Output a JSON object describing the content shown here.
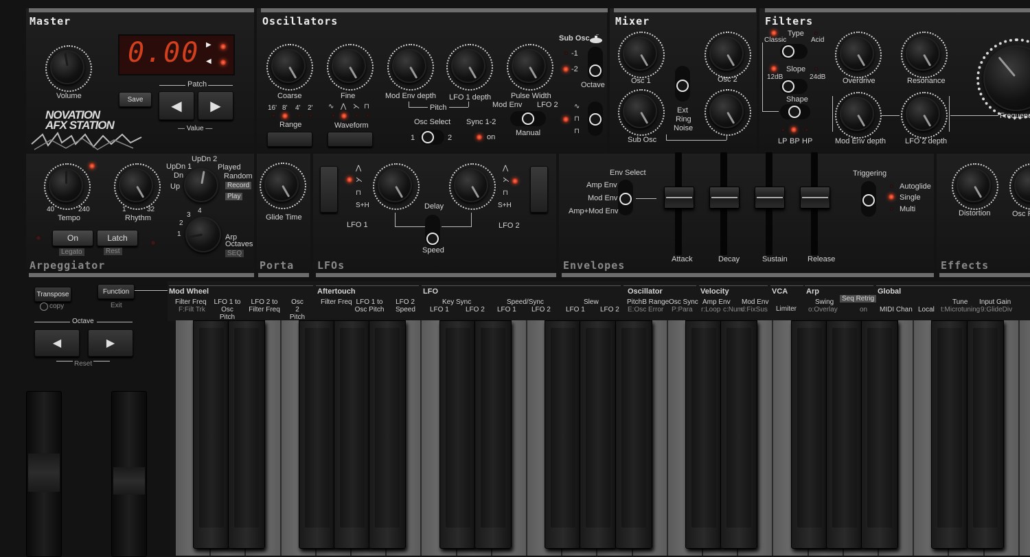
{
  "master": {
    "title": "Master",
    "volume": "Volume",
    "display": "0.00",
    "save": "Save",
    "patch": "Patch",
    "value": "— Value —",
    "brand1": "NOVATION",
    "brand2": "AFX STATION",
    "arrows": [
      "◀",
      "▶"
    ]
  },
  "oscillators": {
    "title": "Oscillators",
    "coarse": "Coarse",
    "fine": "Fine",
    "mod_env_depth": "Mod Env depth",
    "lfo1_depth": "LFO 1 depth",
    "pulse_width": "Pulse Width",
    "pitch": "Pitch",
    "range": "Range",
    "range_opts": [
      "16'",
      "8'",
      "4'",
      "2'"
    ],
    "waveform": "Waveform",
    "waveform_opts": [
      "∿",
      "⋀",
      "⋋",
      "⊓"
    ],
    "osc_select": "Osc Select",
    "osc_sel_1": "1",
    "osc_sel_2": "2",
    "sync": "Sync 1-2",
    "sync_on": "on",
    "mod_env": "Mod Env",
    "lfo2": "LFO 2",
    "manual": "Manual",
    "sub_osc": "Sub Osc",
    "sub_m1": "-1",
    "sub_m2": "-2",
    "octave": "Octave"
  },
  "mixer": {
    "title": "Mixer",
    "osc1": "Osc 1",
    "osc2": "Osc 2",
    "sub_osc": "Sub Osc",
    "ext1": "Ext",
    "ext2": "Ring",
    "ext3": "Noise"
  },
  "filters": {
    "title": "Filters",
    "type": "Type",
    "classic": "Classic",
    "acid": "Acid",
    "slope": "Slope",
    "db12": "12dB",
    "db24": "24dB",
    "shape": "Shape",
    "lp": "LP",
    "bp": "BP",
    "hp": "HP",
    "overdrive": "Overdrive",
    "resonance": "Resonance",
    "mod_env_depth": "Mod Env depth",
    "lfo2_depth": "LFO 2 depth",
    "frequency": "Frequency"
  },
  "arp": {
    "title": "Arpeggiator",
    "updn2": "UpDn 2",
    "updn1": "UpDn 1",
    "played": "Played",
    "dn": "Dn",
    "random": "Random",
    "up": "Up",
    "record": "Record",
    "play": "Play",
    "t40": "40",
    "t240": "240",
    "tempo": "Tempo",
    "r1": "1",
    "r32": "32",
    "rhythm": "Rhythm",
    "on": "On",
    "latch": "Latch",
    "legato": "Legato",
    "rest": "Rest",
    "oct1": "1",
    "oct2": "2",
    "oct3": "3",
    "oct4": "4",
    "arp": "Arp",
    "octaves": "Octaves",
    "seq": "SEQ"
  },
  "porta": {
    "title": "Porta",
    "glide": "Glide Time"
  },
  "lfos": {
    "title": "LFOs",
    "lfo1": "LFO 1",
    "lfo2": "LFO 2",
    "delay": "Delay",
    "speed": "Speed",
    "sh": "S+H",
    "tri": "⋀",
    "saw": "⋋",
    "sq": "⊓"
  },
  "envelopes": {
    "title": "Envelopes",
    "env_select": "Env Select",
    "amp_env": "Amp Env",
    "mod_env": "Mod Env",
    "amp_mod": "Amp+Mod Env",
    "attack": "Attack",
    "decay": "Decay",
    "sustain": "Sustain",
    "release": "Release",
    "triggering": "Triggering",
    "autoglide": "Autoglide",
    "single": "Single",
    "multi": "Multi"
  },
  "effects": {
    "title": "Effects",
    "distortion": "Distortion",
    "osc_fil": "Osc Fil"
  },
  "controls": {
    "transpose": "Transpose",
    "copy": "copy",
    "function": "Function",
    "exit": "Exit",
    "octave": "Octave",
    "reset": "Reset"
  },
  "strip": {
    "mod_wheel": "Mod Wheel",
    "aftertouch": "Aftertouch",
    "lfo": "LFO",
    "oscillator": "Oscillator",
    "velocity": "Velocity",
    "vca": "VCA",
    "arp": "Arp",
    "global": "Global",
    "filter_freq": "Filter Freq",
    "filt_trk": "F:Filt Trk",
    "lfo1_osc_pitch": "LFO 1 to Osc Pitch",
    "lfo2_filter": "LFO 2 to Filter Freq",
    "osc2_pitch": "Osc 2 Pitch",
    "at_filter_freq": "Filter Freq",
    "at_lfo1_osc": "LFO 1 to Osc Pitch",
    "at_lfo2_speed": "LFO 2 Speed",
    "key_sync": "Key Sync",
    "ks_lfo1": "LFO 1",
    "ks_lfo2": "LFO 2",
    "speed_sync": "Speed/Sync",
    "ss_lfo1": "LFO 1",
    "ss_lfo2": "LFO 2",
    "slew": "Slew",
    "sl_lfo1": "LFO 1",
    "sl_lfo2": "LFO 2",
    "pitchb": "PitchB Range",
    "e_osc": "E:Osc Error",
    "osc_sync": "Osc Sync",
    "p_para": "P:Para",
    "amp_env": "Amp Env",
    "r_loop": "r:Loop",
    "c_num": "c:Num",
    "mod_env": "Mod Env",
    "d_fixsus": "d:FixSus",
    "limiter": "Limiter",
    "swing": "Swing",
    "o_overlay": "o:Overlay",
    "seq_retrig": "Seq Retrig",
    "on": "on",
    "midi_chan": "MIDI Chan",
    "local": "Local",
    "tune": "Tune",
    "microtuning": "t:Microtuning",
    "input_gain": "Input Gain",
    "glidediv": "9:GlideDiv"
  }
}
